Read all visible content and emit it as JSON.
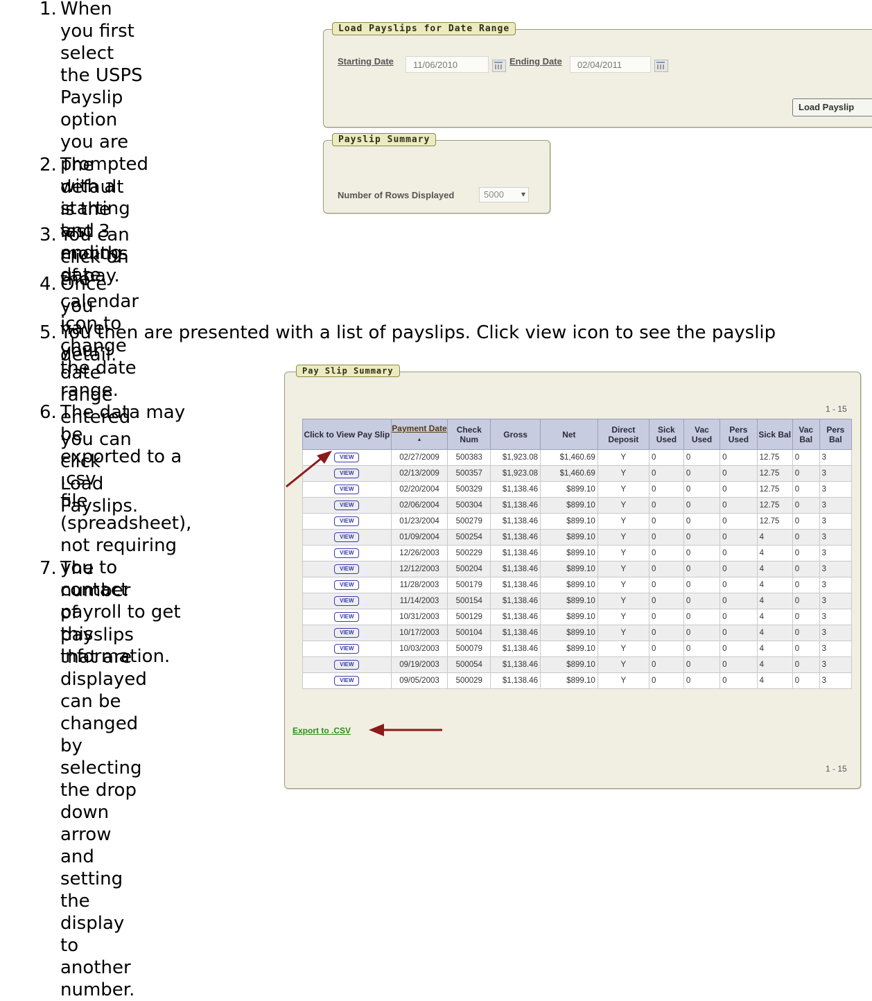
{
  "steps": [
    {
      "num": "1.",
      "lines": [
        "When you first select",
        "the USPS Payslip option",
        "you are prompted with a",
        "starting and ending",
        "date."
      ]
    },
    {
      "num": "2.",
      "lines": [
        "The default is the last 3",
        "months of pay."
      ]
    },
    {
      "num": "3.",
      "lines": [
        "You can click on the calendar icon to change the date range."
      ]
    },
    {
      "num": "4.",
      "lines": [
        "Once you have your date range entered you can click Load Payslips."
      ]
    },
    {
      "num": "5.",
      "lines": [
        "You then are presented with a list of payslips.  Click view icon to see the payslip",
        "detail."
      ]
    },
    {
      "num": "6.",
      "lines": [
        "The data may be",
        "exported to a .csv",
        "file (spreadsheet),",
        "not requiring you to",
        "contact payroll to get",
        "this information."
      ]
    },
    {
      "num": "7.",
      "lines": [
        "The number of",
        "payslips that are",
        "displayed can be",
        "changed by selecting",
        "the drop down arrow",
        "and setting the",
        "display to another",
        "number."
      ]
    }
  ],
  "load_panel": {
    "legend": "Load Payslips for Date Range",
    "start_label": "Starting Date",
    "start_value": "11/06/2010",
    "end_label": "Ending Date",
    "end_value": "02/04/2011",
    "button": "Load Payslip"
  },
  "summary_panel": {
    "legend": "Payslip Summary",
    "rows_label": "Number of Rows Displayed",
    "rows_value": "5000"
  },
  "pay_table": {
    "legend": "Pay Slip Summary",
    "range_top": "1 - 15",
    "range_bottom": "1 - 15",
    "headers": [
      "Click to View Pay Slip",
      "Payment Date",
      "Check Num",
      "Gross",
      "Net",
      "Direct Deposit",
      "Sick Used",
      "Vac Used",
      "Pers Used",
      "Sick Bal",
      "Vac Bal",
      "Pers Bal"
    ],
    "sort_indicator": "▲",
    "view_label": "VIEW",
    "rows": [
      [
        "02/27/2009",
        "500383",
        "$1,923.08",
        "$1,460.69",
        "Y",
        "0",
        "0",
        "0",
        "12.75",
        "0",
        "3"
      ],
      [
        "02/13/2009",
        "500357",
        "$1,923.08",
        "$1,460.69",
        "Y",
        "0",
        "0",
        "0",
        "12.75",
        "0",
        "3"
      ],
      [
        "02/20/2004",
        "500329",
        "$1,138.46",
        "$899.10",
        "Y",
        "0",
        "0",
        "0",
        "12.75",
        "0",
        "3"
      ],
      [
        "02/06/2004",
        "500304",
        "$1,138.46",
        "$899.10",
        "Y",
        "0",
        "0",
        "0",
        "12.75",
        "0",
        "3"
      ],
      [
        "01/23/2004",
        "500279",
        "$1,138.46",
        "$899.10",
        "Y",
        "0",
        "0",
        "0",
        "12.75",
        "0",
        "3"
      ],
      [
        "01/09/2004",
        "500254",
        "$1,138.46",
        "$899.10",
        "Y",
        "0",
        "0",
        "0",
        "4",
        "0",
        "3"
      ],
      [
        "12/26/2003",
        "500229",
        "$1,138.46",
        "$899.10",
        "Y",
        "0",
        "0",
        "0",
        "4",
        "0",
        "3"
      ],
      [
        "12/12/2003",
        "500204",
        "$1,138.46",
        "$899.10",
        "Y",
        "0",
        "0",
        "0",
        "4",
        "0",
        "3"
      ],
      [
        "11/28/2003",
        "500179",
        "$1,138.46",
        "$899.10",
        "Y",
        "0",
        "0",
        "0",
        "4",
        "0",
        "3"
      ],
      [
        "11/14/2003",
        "500154",
        "$1,138.46",
        "$899.10",
        "Y",
        "0",
        "0",
        "0",
        "4",
        "0",
        "3"
      ],
      [
        "10/31/2003",
        "500129",
        "$1,138.46",
        "$899.10",
        "Y",
        "0",
        "0",
        "0",
        "4",
        "0",
        "3"
      ],
      [
        "10/17/2003",
        "500104",
        "$1,138.46",
        "$899.10",
        "Y",
        "0",
        "0",
        "0",
        "4",
        "0",
        "3"
      ],
      [
        "10/03/2003",
        "500079",
        "$1,138.46",
        "$899.10",
        "Y",
        "0",
        "0",
        "0",
        "4",
        "0",
        "3"
      ],
      [
        "09/19/2003",
        "500054",
        "$1,138.46",
        "$899.10",
        "Y",
        "0",
        "0",
        "0",
        "4",
        "0",
        "3"
      ],
      [
        "09/05/2003",
        "500029",
        "$1,138.46",
        "$899.10",
        "Y",
        "0",
        "0",
        "0",
        "4",
        "0",
        "3"
      ]
    ],
    "export_label": "Export to .CSV"
  },
  "colors": {
    "arrow": "#8b1a1a",
    "legend_bg": "#ecebc0",
    "panel_bg": "#f1efe2",
    "header_bg": "#c7cce0",
    "export_link": "#2e8b1e"
  }
}
